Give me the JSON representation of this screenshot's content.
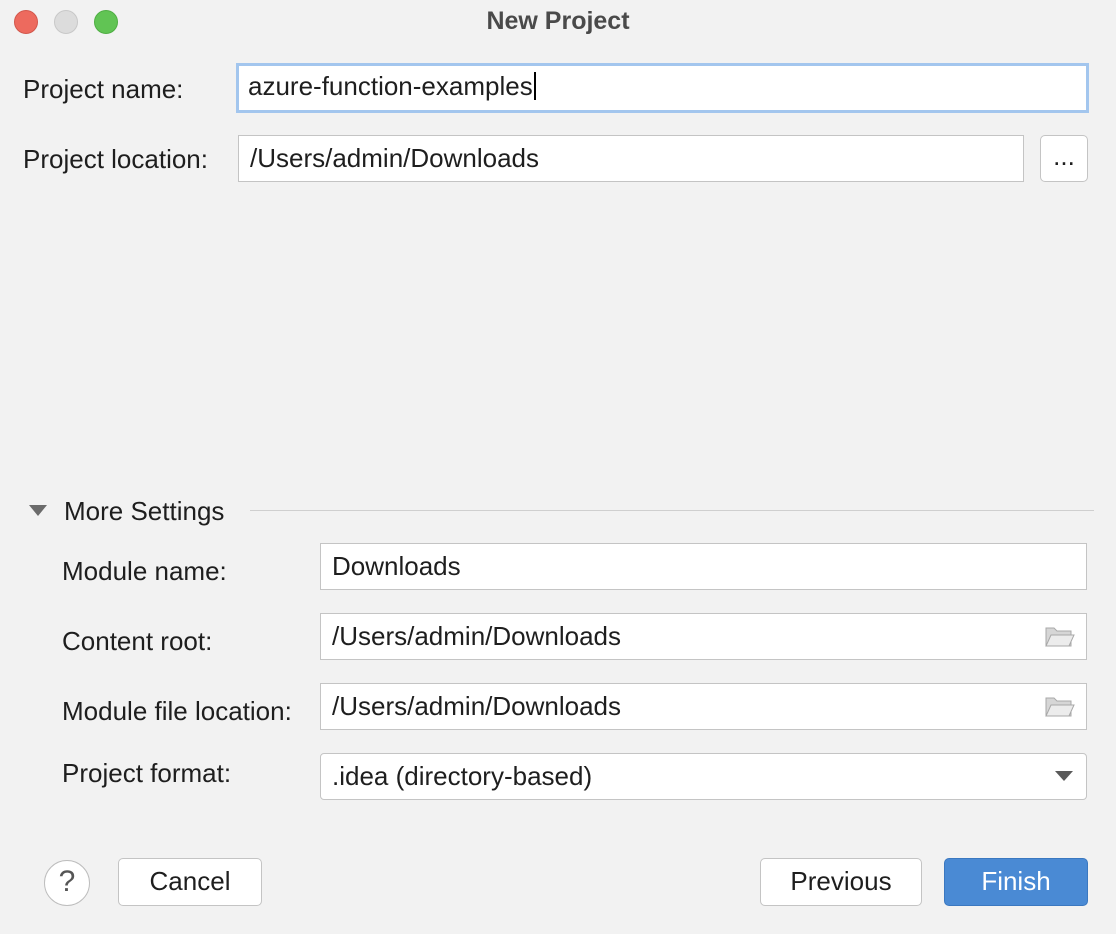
{
  "window": {
    "title": "New Project"
  },
  "form": {
    "project_name_label": "Project name:",
    "project_name_value": "azure-function-examples",
    "project_location_label": "Project location:",
    "project_location_value": "/Users/admin/Downloads",
    "browse_label": "..."
  },
  "more_settings": {
    "header": "More Settings",
    "expanded": true,
    "module_name_label": "Module name:",
    "module_name_value": "Downloads",
    "content_root_label": "Content root:",
    "content_root_value": "/Users/admin/Downloads",
    "module_file_location_label": "Module file location:",
    "module_file_location_value": "/Users/admin/Downloads",
    "project_format_label": "Project format:",
    "project_format_value": ".idea (directory-based)"
  },
  "footer": {
    "help_label": "?",
    "cancel_label": "Cancel",
    "previous_label": "Previous",
    "finish_label": "Finish"
  },
  "icons": {
    "folder": "folder-icon",
    "dropdown": "chevron-down-icon",
    "disclosure": "disclosure-triangle-icon"
  },
  "colors": {
    "accent": "#4a8ad4",
    "focus_ring": "#a3c6ee",
    "close": "#ed6a5e",
    "minimize": "#dcdcdc",
    "maximize": "#61c454"
  }
}
